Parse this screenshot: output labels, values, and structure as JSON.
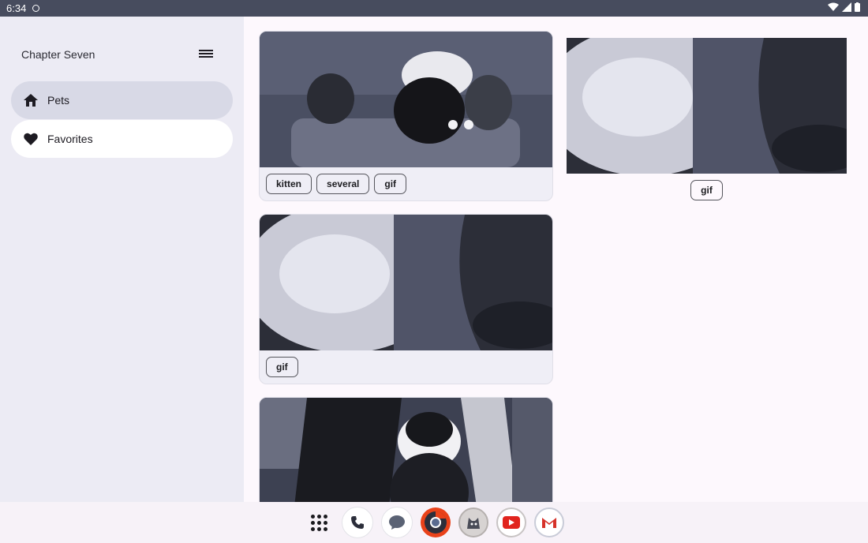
{
  "status": {
    "time": "6:34"
  },
  "drawer": {
    "title": "Chapter Seven",
    "items": [
      {
        "label": "Pets",
        "icon": "home-icon",
        "selected": true
      },
      {
        "label": "Favorites",
        "icon": "heart-icon",
        "selected": false
      }
    ]
  },
  "cards": [
    {
      "tags": [
        "kitten",
        "several",
        "gif"
      ]
    },
    {
      "tags": [
        "gif"
      ]
    },
    {
      "tags": []
    }
  ],
  "right_card": {
    "tags": [
      "gif"
    ]
  },
  "dock": {
    "apps": [
      "app-drawer-icon",
      "phone-icon",
      "messages-icon",
      "chrome-icon",
      "cat-app-icon",
      "youtube-icon",
      "gmail-icon"
    ]
  },
  "colors": {
    "status_bar": "#474c5e",
    "drawer_bg": "#ecebf4",
    "nav_active": "#d8d9e6",
    "content_bg": "#fdf8fd"
  }
}
